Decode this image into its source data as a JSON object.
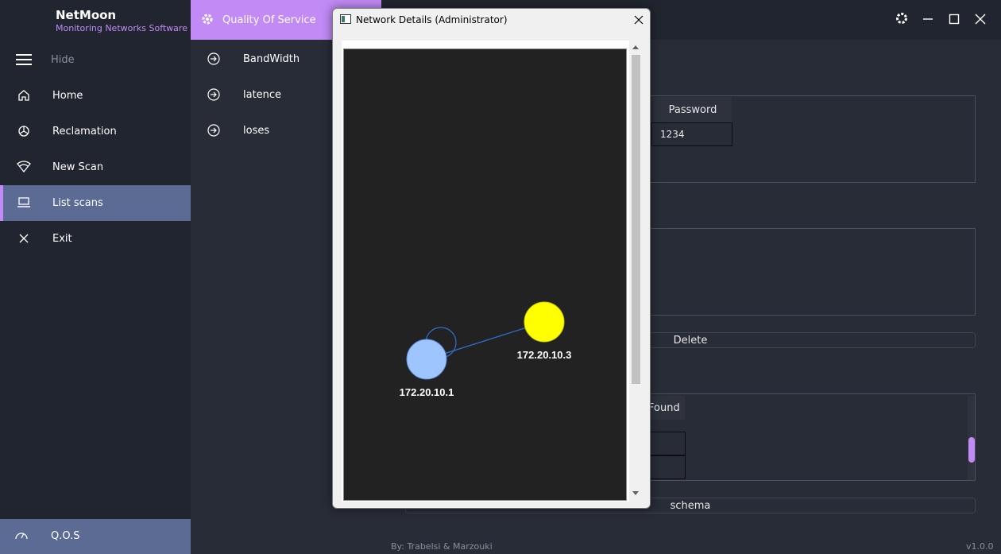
{
  "brand": {
    "name": "NetMoon",
    "subtitle": "Monitoring Networks Software"
  },
  "sidebar": {
    "hide_label": "Hide",
    "items": [
      {
        "label": "Home",
        "icon": "home-icon"
      },
      {
        "label": "Reclamation",
        "icon": "pie-chart-icon"
      },
      {
        "label": "New Scan",
        "icon": "wifi-icon"
      },
      {
        "label": "List scans",
        "icon": "laptop-icon",
        "active": true
      },
      {
        "label": "Exit",
        "icon": "close-icon"
      }
    ],
    "footer_item": {
      "label": "Q.O.S",
      "icon": "speedometer-icon"
    }
  },
  "submenu": {
    "title": "Quality Of Service",
    "items": [
      {
        "label": "BandWidth",
        "icon": "arrow-circle-right-icon"
      },
      {
        "label": "latence",
        "icon": "arrow-circle-right-icon"
      },
      {
        "label": "loses",
        "icon": "arrow-circle-right-icon"
      }
    ]
  },
  "main": {
    "credentials": {
      "header": "Password",
      "value": "1234"
    },
    "delete_label": "Delete",
    "found_header": "Found",
    "schema_label": "schema",
    "footer_credit": "By: Trabelsi & Marzouki",
    "version": "v1.0.0"
  },
  "dialog": {
    "title": "Network Details (Administrator)",
    "graph": {
      "nodes": [
        {
          "label": "172.20.10.1",
          "color": "#9ec5fe"
        },
        {
          "label": "172.20.10.3",
          "color": "#ffff00"
        }
      ],
      "edge_color": "#2f6fd0"
    }
  },
  "colors": {
    "accent": "#c18af5",
    "sidebar_bg": "#21252f",
    "active_bg": "#5b6b94",
    "content_bg": "#282c37"
  }
}
